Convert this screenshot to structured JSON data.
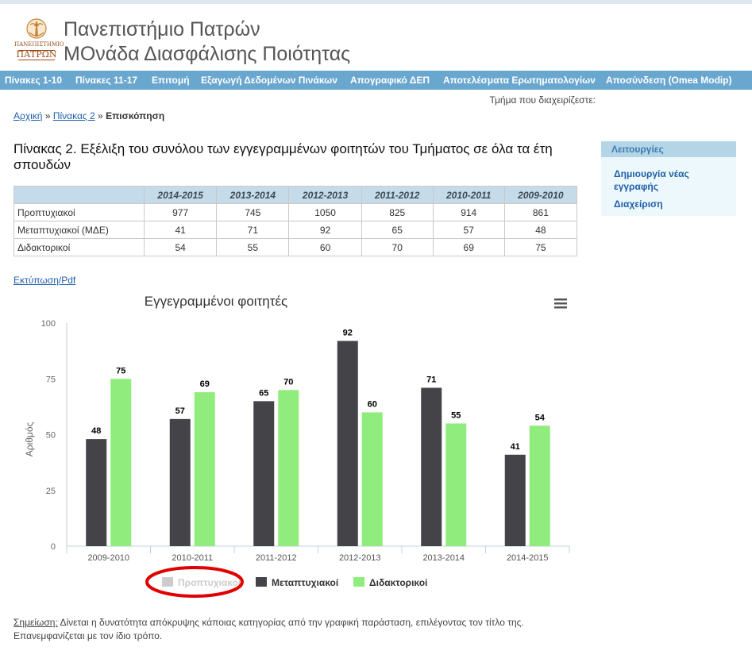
{
  "header": {
    "logo_text_top": "ΠΑΝΕΠΙΣΤΗΜΙΟ",
    "logo_text_bottom": "ΠΑΤΡΩΝ",
    "university": "Πανεπιστήμιο Πατρών",
    "unit": "ΜΟνάδα Διασφάλισης Ποιότητας"
  },
  "nav": {
    "items": [
      {
        "label": "Πίνακες 1-10"
      },
      {
        "label": "Πίνακες 11-17"
      },
      {
        "label": "Επιτομή"
      },
      {
        "label": "Εξαγωγή Δεδομένων Πινάκων"
      },
      {
        "label": "Απογραφικό ΔΕΠ"
      },
      {
        "label": "Αποτελέσματα Ερωτηματολογίων"
      },
      {
        "label": "Αποσύνδεση (Omea Modip)"
      }
    ]
  },
  "dept_label": "Τμήμα που διαχειρίζεστε:",
  "breadcrumb": {
    "home": "Αρχική",
    "sep": "»",
    "table": "Πίνακας 2",
    "current": "Επισκόπηση"
  },
  "page_title": "Πίνακας 2. Εξέλιξη του συνόλου των εγγεγραμμένων φοιτητών του Τμήματος σε όλα τα έτη σπουδών",
  "table": {
    "headers": [
      "",
      "2014-2015",
      "2013-2014",
      "2012-2013",
      "2011-2012",
      "2010-2011",
      "2009-2010"
    ],
    "rows": [
      {
        "name": "Προπτυχιακοί",
        "values": [
          "977",
          "745",
          "1050",
          "825",
          "914",
          "861"
        ]
      },
      {
        "name": "Μεταπτυχιακοί (ΜΔΕ)",
        "values": [
          "41",
          "71",
          "92",
          "65",
          "57",
          "48"
        ]
      },
      {
        "name": "Διδακτορικοί",
        "values": [
          "54",
          "55",
          "60",
          "70",
          "69",
          "75"
        ]
      }
    ]
  },
  "print_link": "Εκτύπωση/Pdf",
  "chart_data": {
    "type": "bar",
    "title": "Εγγεγραμμένοι φοιτητές",
    "xlabel": "",
    "ylabel": "Αριθμός",
    "ylim": [
      0,
      100
    ],
    "yticks": [
      0,
      25,
      50,
      75,
      100
    ],
    "categories": [
      "2009-2010",
      "2010-2011",
      "2011-2012",
      "2012-2013",
      "2013-2014",
      "2014-2015"
    ],
    "series": [
      {
        "name": "Προπτυχιακοί",
        "values": [
          861,
          914,
          825,
          1050,
          745,
          977
        ],
        "color": "#cccccc",
        "hidden": true
      },
      {
        "name": "Μεταπτυχιακοί",
        "values": [
          48,
          57,
          65,
          92,
          71,
          41
        ],
        "color": "#434348",
        "hidden": false
      },
      {
        "name": "Διδακτορικοί",
        "values": [
          75,
          69,
          70,
          60,
          55,
          54
        ],
        "color": "#90ed7d",
        "hidden": false
      }
    ],
    "legend_position": "bottom-center",
    "grid": false,
    "highlight_color": "#e00000"
  },
  "sidebar": {
    "title": "Λειτουργίες",
    "links": [
      {
        "label_line1": "Δημιουργία νέας",
        "label_line2": "εγγραφής"
      },
      {
        "label": "Διαχείριση"
      }
    ]
  },
  "note": {
    "label": "Σημείωση:",
    "text": " Δίνεται η δυνατότητα απόκρυψης κάποιας κατηγορίας από την γραφική παράσταση, επιλέγοντας τον τίτλο της. Επανεμφανίζεται με τον ίδιο τρόπο."
  },
  "colors": {
    "nav_bg": "#6aa7cf",
    "link": "#1f5fa8",
    "table_header_bg": "#c6dbe9",
    "sidebar_bg": "#ecf8fb"
  }
}
